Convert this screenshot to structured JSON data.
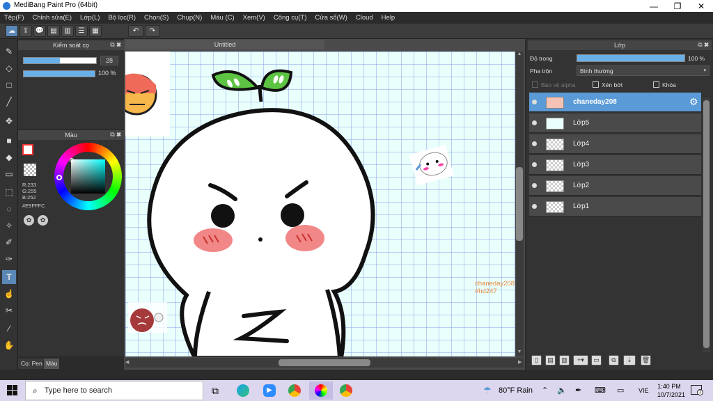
{
  "window": {
    "title": "MediBang Paint Pro (64bit)",
    "minimize": "—",
    "maximize": "❐",
    "close": "✕"
  },
  "menu": [
    "Tệp(F)",
    "Chỉnh sửa(E)",
    "Lớp(L)",
    "Bộ lọc(R)",
    "Chọn(S)",
    "Chụp(N)",
    "Màu (C)",
    "Xem(V)",
    "Công cụ(T)",
    "Cửa sổ(W)",
    "Cloud",
    "Help"
  ],
  "brush_panel": {
    "title": "Kiểm soát cọ",
    "size_value": "28",
    "size_fraction": 0.5,
    "opacity_value": "100 %",
    "opacity_fraction": 1.0
  },
  "color_panel": {
    "title": "Màu",
    "r": "R:233",
    "g": "G:255",
    "b": "B:252",
    "hex": "#E9FFFC",
    "color_hex": "#e9fffc"
  },
  "bottom_tabs": {
    "pen": "Cọ: Pen",
    "color": "Màu"
  },
  "document": {
    "tab": "Untitled"
  },
  "canvas": {
    "watermark_line1": "chaneday208",
    "watermark_line2": "#hd247",
    "z_letter": "Z"
  },
  "layers_panel": {
    "title": "Lớp",
    "opacity_label": "Độ trong",
    "opacity_value": "100 %",
    "opacity_fraction": 1.0,
    "blend_label": "Pha trộn",
    "blend_value": "Bình thường",
    "protect_alpha": "Bảo vệ alpha",
    "clipping": "Xén bớt",
    "lock": "Khóa",
    "layers": [
      {
        "name": "chaneday208",
        "selected": true
      },
      {
        "name": "Lớp5",
        "selected": false
      },
      {
        "name": "Lớp4",
        "selected": false
      },
      {
        "name": "Lớp3",
        "selected": false
      },
      {
        "name": "Lớp2",
        "selected": false
      },
      {
        "name": "Lớp1",
        "selected": false
      }
    ]
  },
  "taskbar": {
    "search_placeholder": "Type here to search",
    "weather": "80°F  Rain",
    "language": "VIE",
    "time": "1:40 PM",
    "date": "10/7/2021",
    "notification_count": "1"
  }
}
